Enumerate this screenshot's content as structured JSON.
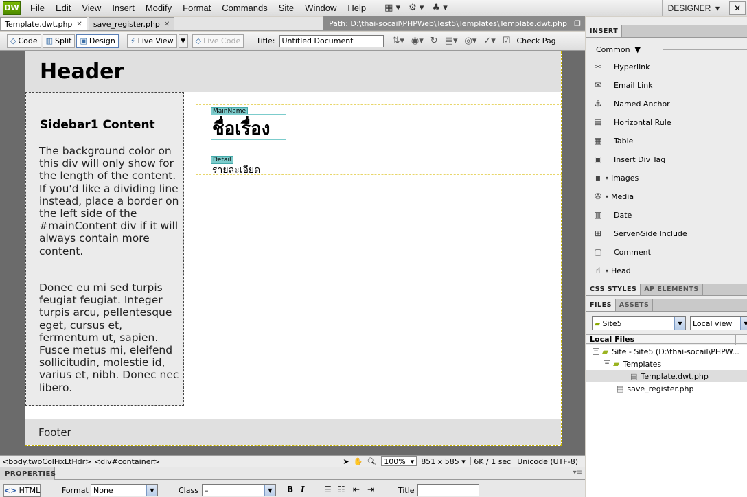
{
  "app": {
    "logo": "DW",
    "menu": [
      "File",
      "Edit",
      "View",
      "Insert",
      "Modify",
      "Format",
      "Commands",
      "Site",
      "Window",
      "Help"
    ],
    "workspace": "DESIGNER"
  },
  "tabs": [
    {
      "label": "Template.dwt.php",
      "active": true
    },
    {
      "label": "save_register.php",
      "active": false
    }
  ],
  "path": "Path:  D:\\thai-socail\\PHPWeb\\Test5\\Templates\\Template.dwt.php",
  "toolbar": {
    "code": "Code",
    "split": "Split",
    "design": "Design",
    "live_view": "Live View",
    "live_code": "Live Code",
    "title_label": "Title:",
    "title_value": "Untitled Document",
    "check_page": "Check Pag"
  },
  "page": {
    "header": "Header",
    "sidebar_title": "Sidebar1 Content",
    "sidebar_p1": "The background color on this div will only show for the length of the content. If you'd like a dividing line instead, place a border on the left side of the #mainContent div if it will always contain more content.",
    "sidebar_p2": "Donec eu mi sed turpis feugiat feugiat. Integer turpis arcu, pellentesque eget, cursus et, fermentum ut, sapien. Fusce metus mi, eleifend sollicitudin, molestie id, varius et, nibh. Donec nec libero.",
    "region_mainname": "MainName",
    "mainname_text": "ชื่อเรื่อง",
    "region_detail": "Detail",
    "detail_text": "รายละเอียด",
    "footer": "Footer"
  },
  "status": {
    "tags": "<body.twoColFixLtHdr> <div#container>",
    "zoom": "100%",
    "size": "851 x 585",
    "download": "6K / 1 sec",
    "encoding": "Unicode (UTF-8)"
  },
  "properties": {
    "title": "PROPERTIES",
    "html_button": "HTML",
    "format_label": "Format",
    "format_value": "None",
    "class_label": "Class",
    "class_value": "–",
    "bold": "B",
    "italic": "I",
    "title_label": "Title"
  },
  "insert_panel": {
    "tab": "INSERT",
    "category": "Common",
    "items": [
      {
        "label": "Hyperlink",
        "icon": "hyperlink-icon",
        "dropdown": false
      },
      {
        "label": "Email Link",
        "icon": "email-icon",
        "dropdown": false
      },
      {
        "label": "Named Anchor",
        "icon": "anchor-icon",
        "dropdown": false
      },
      {
        "label": "Horizontal Rule",
        "icon": "rule-icon",
        "dropdown": false
      },
      {
        "label": "Table",
        "icon": "table-icon",
        "dropdown": false
      },
      {
        "label": "Insert Div Tag",
        "icon": "div-tag-icon",
        "dropdown": false
      },
      {
        "label": "Images",
        "icon": "image-icon",
        "dropdown": true
      },
      {
        "label": "Media",
        "icon": "media-icon",
        "dropdown": true
      },
      {
        "label": "Date",
        "icon": "date-icon",
        "dropdown": false
      },
      {
        "label": "Server-Side Include",
        "icon": "include-icon",
        "dropdown": false
      },
      {
        "label": "Comment",
        "icon": "comment-icon",
        "dropdown": false
      },
      {
        "label": "Head",
        "icon": "head-icon",
        "dropdown": true
      }
    ]
  },
  "css_panel": {
    "tab1": "CSS STYLES",
    "tab2": "AP ELEMENTS"
  },
  "files_panel": {
    "tab1": "FILES",
    "tab2": "ASSETS",
    "site": "Site5",
    "view": "Local view",
    "header": "Local Files",
    "tree": [
      {
        "label": "Site - Site5 (D:\\thai-socail\\PHPW...",
        "type": "site"
      },
      {
        "label": "Templates",
        "type": "folder"
      },
      {
        "label": "Template.dwt.php",
        "type": "file"
      },
      {
        "label": "save_register.php",
        "type": "file"
      }
    ]
  }
}
